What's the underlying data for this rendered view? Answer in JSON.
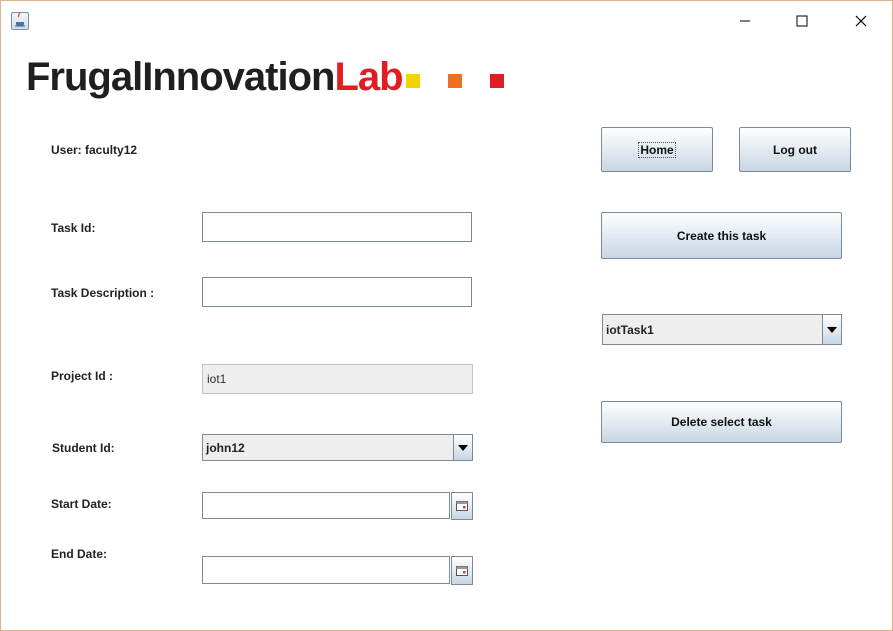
{
  "window": {
    "minimize_icon": "minimize-icon",
    "maximize_icon": "maximize-icon",
    "close_icon": "close-icon",
    "app_icon": "java-icon"
  },
  "logo": {
    "part1": "FrugalInnovation",
    "part2": "Lab",
    "square_colors": [
      "#f2d500",
      "#f07020",
      "#e31b23"
    ]
  },
  "user_label": "User: faculty12",
  "buttons": {
    "home": "Home",
    "logout": "Log out",
    "create": "Create this task",
    "delete": "Delete select task"
  },
  "form": {
    "task_id_label": "Task Id:",
    "task_id_value": "",
    "task_desc_label": "Task Description :",
    "task_desc_value": "",
    "project_id_label": "Project Id :",
    "project_id_value": "iot1",
    "student_id_label": "Student Id:",
    "student_id_value": "john12",
    "start_date_label": "Start Date:",
    "start_date_value": "",
    "end_date_label": "End Date:",
    "end_date_value": ""
  },
  "task_select": {
    "value": "iotTask1"
  }
}
